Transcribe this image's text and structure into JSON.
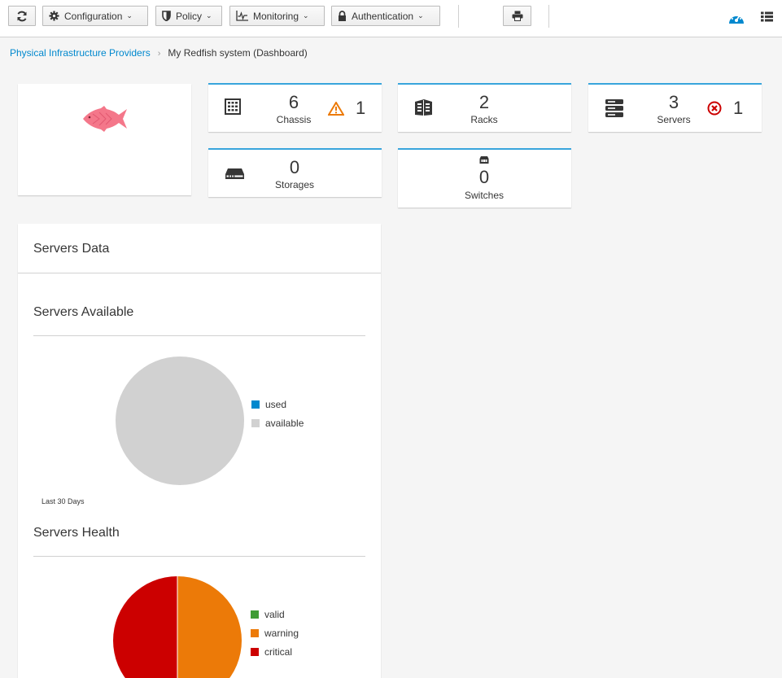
{
  "toolbar": {
    "refresh_icon": "refresh-icon",
    "configuration_label": "Configuration",
    "policy_label": "Policy",
    "monitoring_label": "Monitoring",
    "authentication_label": "Authentication",
    "print_icon": "print-icon",
    "dashboard_view_icon": "tachometer-icon",
    "list_view_icon": "list-icon"
  },
  "breadcrumb": {
    "parent": "Physical Infrastructure Providers",
    "separator": "›",
    "current": "My Redfish system (Dashboard)"
  },
  "stats": {
    "chassis": {
      "value": "6",
      "label": "Chassis",
      "warning_count": "1"
    },
    "racks": {
      "value": "2",
      "label": "Racks"
    },
    "servers": {
      "value": "3",
      "label": "Servers",
      "error_count": "1"
    },
    "storages": {
      "value": "0",
      "label": "Storages"
    },
    "switches": {
      "value": "0",
      "label": "Switches"
    }
  },
  "servers_data": {
    "title": "Servers Data",
    "available": {
      "title": "Servers Available",
      "legend": [
        {
          "label": "used",
          "color": "#0088ce"
        },
        {
          "label": "available",
          "color": "#d1d1d1"
        }
      ],
      "caption": "Last 30 Days"
    },
    "health": {
      "title": "Servers Health",
      "legend": [
        {
          "label": "valid",
          "color": "#3f9c35"
        },
        {
          "label": "warning",
          "color": "#ec7a08"
        },
        {
          "label": "critical",
          "color": "#cc0000"
        }
      ]
    }
  },
  "colors": {
    "accent": "#39a5dc",
    "link": "#0088ce",
    "warning": "#ec7a08",
    "error": "#cc0000",
    "logo": "#f4778a"
  }
}
